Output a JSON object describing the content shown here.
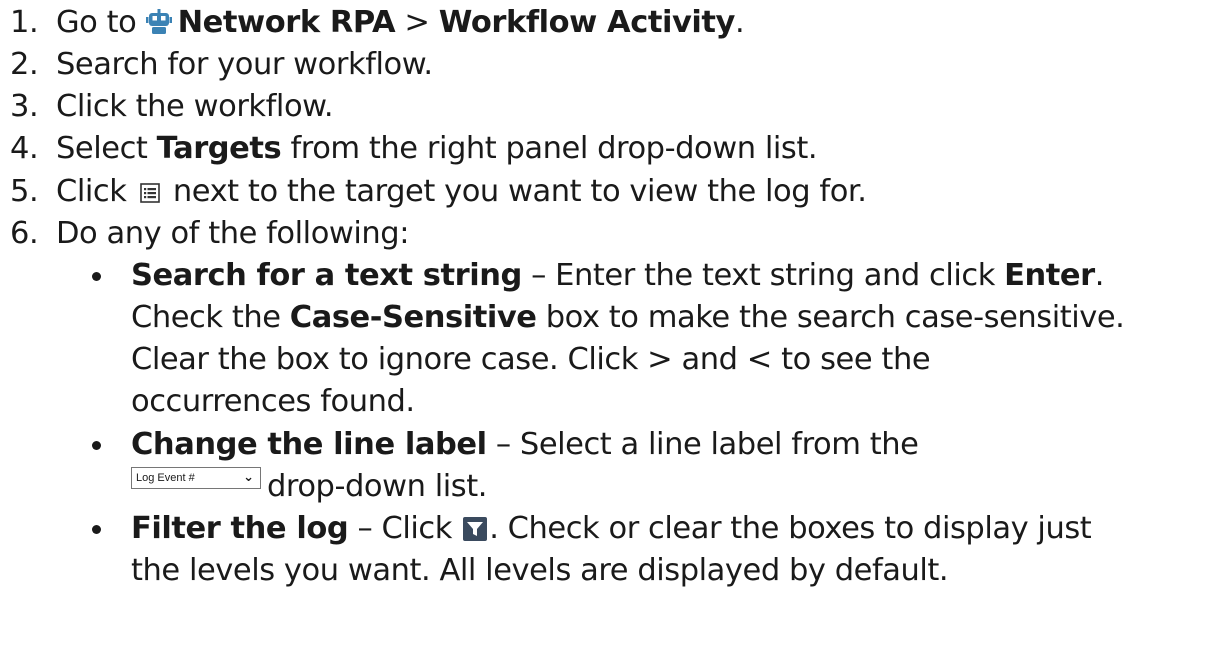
{
  "steps": [
    {
      "num": "1.",
      "pre": "Go to ",
      "icon": "robot-icon",
      "b1": "Network RPA",
      "mid": " > ",
      "b2": "Workflow Activity",
      "post": "."
    },
    {
      "num": "2.",
      "text": "Search for your workflow."
    },
    {
      "num": "3.",
      "text": "Click the workflow."
    },
    {
      "num": "4.",
      "pre": "Select ",
      "bold": "Targets",
      "post": " from the right panel drop-down list."
    },
    {
      "num": "5.",
      "pre": "Click ",
      "icon": "list-icon",
      "post": " next to the target you want to view the log for."
    },
    {
      "num": "6.",
      "text": "Do any of the following:"
    }
  ],
  "bullets": {
    "search": {
      "bold": "Search for a text string",
      "text1": " – Enter the text string and click ",
      "bold2": "Enter",
      "text2": ".",
      "line2_pre": "Check the ",
      "line2_bold": "Case-Sensitive",
      "line2_post": " box to make the search case-sensitive.",
      "line3": "Clear the box to ignore case. Click > and < to see the",
      "line4": "occurrences found."
    },
    "label": {
      "bold": "Change the line label",
      "text1": " – Select a line label from the",
      "dropdown_value": "Log Event #",
      "line2_post": "drop-down list."
    },
    "filter": {
      "bold": "Filter the log",
      "text1": " – Click ",
      "icon": "filter-icon",
      "text2": ". Check or clear the boxes to display just",
      "line2": "the levels you want. All levels are displayed by default."
    }
  },
  "colors": {
    "text": "#1a1a1a",
    "robot": "#3b82b4",
    "filter_bg": "#3a4a5e"
  }
}
